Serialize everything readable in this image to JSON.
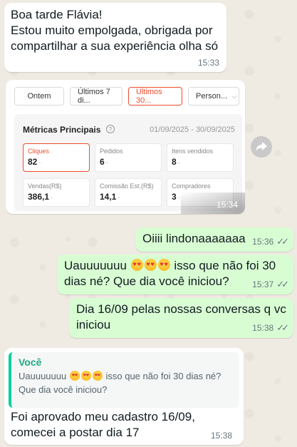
{
  "messages": {
    "m1": {
      "line1": "Boa tarde Flávia!",
      "line2": "Estou muito empolgada, obrigada por",
      "line3": "compartilhar a sua experiência olha só",
      "time": "15:33"
    },
    "image": {
      "filters": [
        "Ontem",
        "Últimos 7 di...",
        "Últimos 30...",
        "Person..."
      ],
      "panel_title": "Métricas Principais",
      "date_range": "01/09/2025 - 30/09/2025",
      "metrics": [
        {
          "label": "Cliques",
          "value": "82"
        },
        {
          "label": "Pedidos",
          "value": "6"
        },
        {
          "label": "Itens vendidos",
          "value": "8"
        },
        {
          "label": "Vendas(R$)",
          "value": "386,1"
        },
        {
          "label": "Comissão Est.(R$)",
          "value": "14,1"
        },
        {
          "label": "Compradores",
          "value": "3"
        }
      ],
      "dash": "-",
      "time": "15:34"
    },
    "m2": {
      "text": "Oiiii lindonaaaaaaa",
      "time": "15:36"
    },
    "m3": {
      "line1_a": "Uauuuuuuu",
      "line1_b": "isso que não foi 30",
      "line2": "dias né? Que dia você iniciou?",
      "time": "15:37"
    },
    "m4": {
      "line1": "Dia 16/09 pelas nossas conversas q vc",
      "line2": "iniciou",
      "time": "15:38"
    },
    "m5": {
      "quote_author": "Você",
      "quote_line1_a": "Uauuuuuuu",
      "quote_line1_b": "isso que não foi 30 dias né?",
      "quote_line2": "Que dia você iniciou?",
      "line1": "Foi aprovado meu cadastro 16/09,",
      "line2": "comecei a postar dia 17",
      "time": "15:38"
    }
  },
  "icons": {
    "read": "double-check-icon",
    "forward": "forward-icon",
    "emoji": "heart-eyes-emoji",
    "help": "question-circle-icon",
    "caret": "chevron-down-icon"
  },
  "colors": {
    "incoming": "#ffffff",
    "outgoing": "#d9fdd3",
    "accent": "#ee4d2d",
    "quote_bar": "#06cf9c"
  }
}
